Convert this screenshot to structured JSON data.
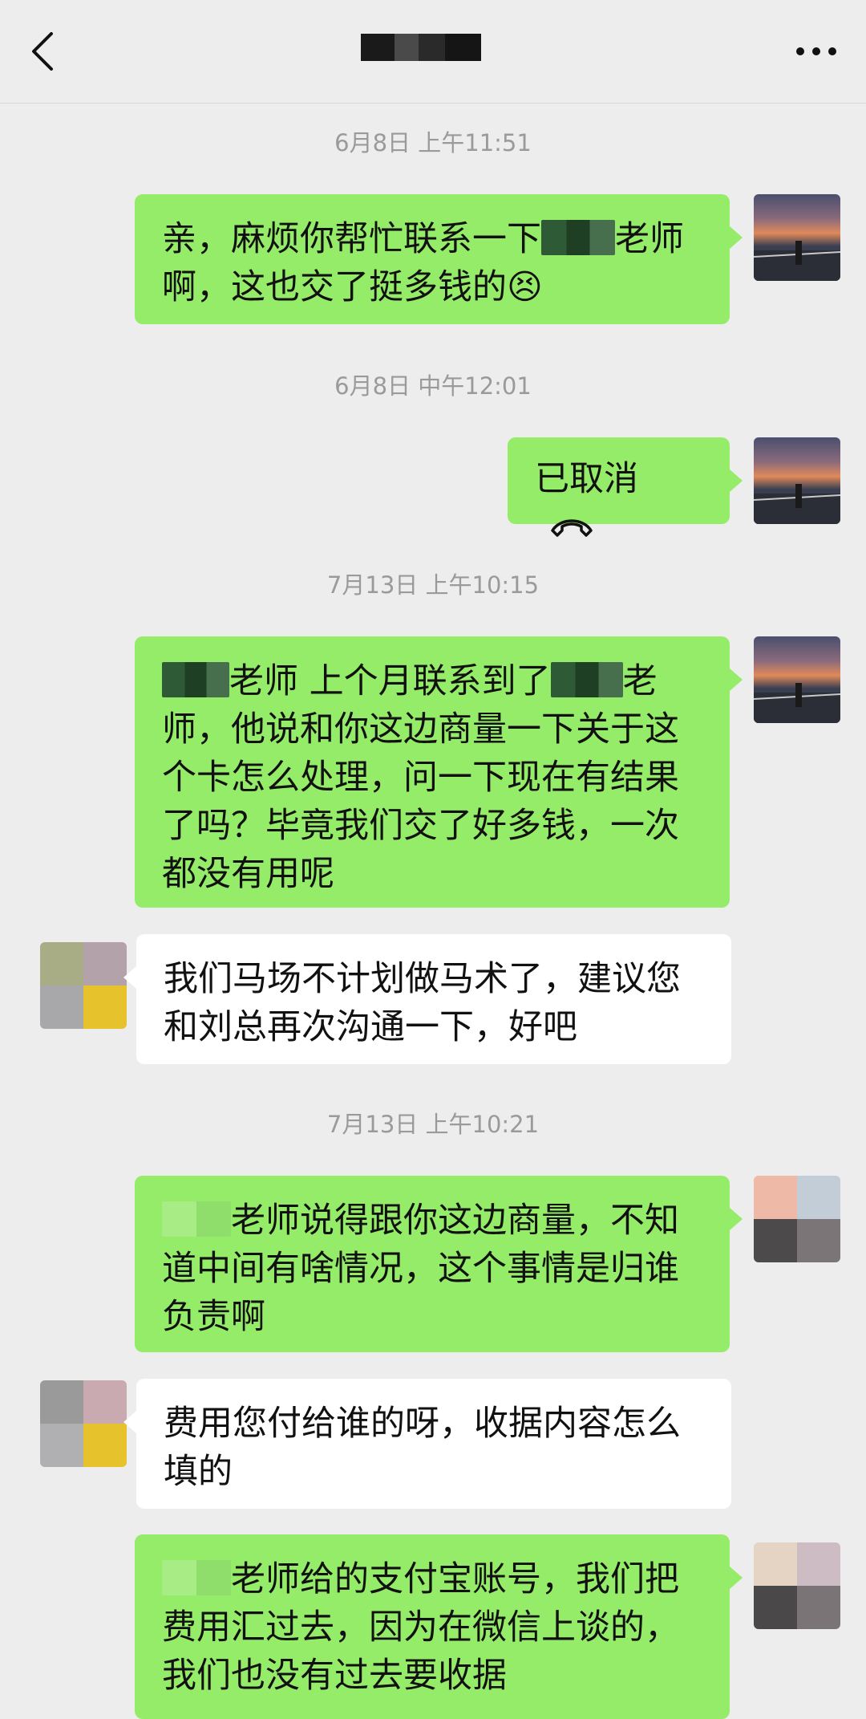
{
  "header": {
    "back_icon": "chevron-left-icon",
    "more_icon": "ellipsis-icon"
  },
  "timestamps": [
    "6月8日 上午11:51",
    "6月8日 中午12:01",
    "7月13日 上午10:15",
    "7月13日 上午10:21"
  ],
  "messages": [
    {
      "side": "me",
      "text_a": "亲，麻烦你帮忙联系一下",
      "text_b": "老师",
      "text_c": "啊，这也交了挺多钱的",
      "emoji": "😣"
    },
    {
      "side": "me",
      "text": "已取消",
      "icon": "phone-hangup-icon"
    },
    {
      "side": "me",
      "text_a": "老师  上个月联系到了",
      "text_b": "老",
      "text_c": "师，他说和你这边商量一下关于这个卡怎么处理，问一下现在有结果了吗？毕竟我们交了好多钱，一次都没有用呢"
    },
    {
      "side": "other",
      "text": "我们马场不计划做马术了，建议您和刘总再次沟通一下，好吧"
    },
    {
      "side": "me",
      "text": "老师说得跟你这边商量，不知道中间有啥情况，这个事情是归谁负责啊"
    },
    {
      "side": "other",
      "text": "费用您付给谁的呀，收据内容怎么填的"
    },
    {
      "side": "me",
      "text": "老师给的支付宝账号，我们把费用汇过去，因为在微信上谈的，我们也没有过去要收据"
    }
  ],
  "colors": {
    "background": "#ededed",
    "my_bubble": "#95ec69",
    "other_bubble": "#ffffff",
    "timestamp_text": "#9a9a9a"
  }
}
